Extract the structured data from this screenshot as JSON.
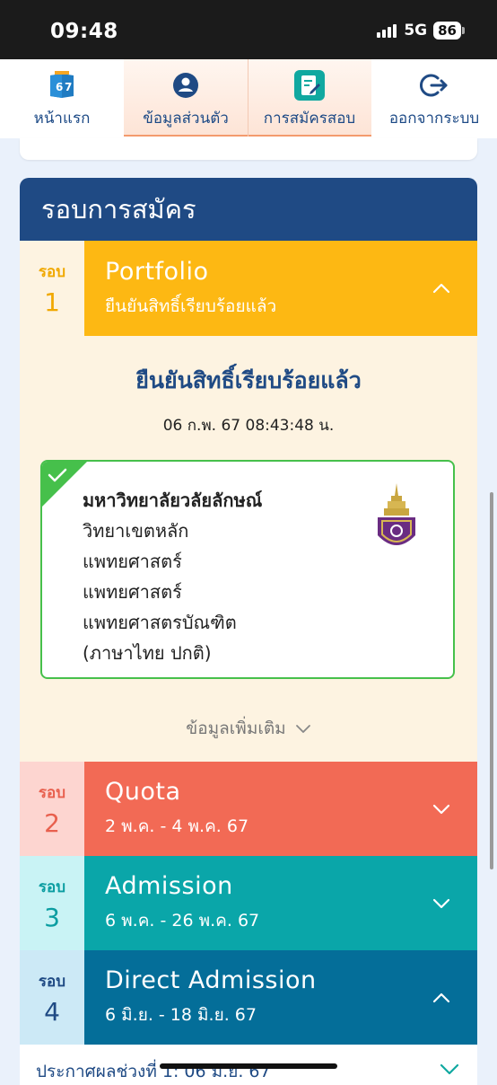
{
  "status_bar": {
    "time": "09:48",
    "network": "5G",
    "battery": "86"
  },
  "nav": {
    "items": [
      {
        "label": "หน้าแรก",
        "icon": "home-67-icon",
        "active": false
      },
      {
        "label": "ข้อมูลส่วนตัว",
        "icon": "profile-icon",
        "active": true
      },
      {
        "label": "การสมัครสอบ",
        "icon": "application-form-icon",
        "active": true
      },
      {
        "label": "ออกจากระบบ",
        "icon": "logout-icon",
        "active": false
      }
    ]
  },
  "panel": {
    "title": "รอบการสมัคร"
  },
  "rounds": [
    {
      "round_label": "รอบ",
      "number": "1",
      "name": "Portfolio",
      "subtitle": "ยืนยันสิทธิ์เรียบร้อยแล้ว",
      "expanded": true,
      "left_bg": "#fdf3e1",
      "right_bg": "#fdb813",
      "label_color": "#f0a800"
    },
    {
      "round_label": "รอบ",
      "number": "2",
      "name": "Quota",
      "subtitle": "2 พ.ค. - 4 พ.ค. 67",
      "expanded": false,
      "left_bg": "#fdd5d0",
      "right_bg": "#f26a55",
      "label_color": "#e8604e"
    },
    {
      "round_label": "รอบ",
      "number": "3",
      "name": "Admission",
      "subtitle": "6 พ.ค. - 26 พ.ค. 67",
      "expanded": false,
      "left_bg": "#c9f3f5",
      "right_bg": "#0aa6a9",
      "label_color": "#0a9da1"
    },
    {
      "round_label": "รอบ",
      "number": "4",
      "name": "Direct Admission",
      "subtitle": "6 มิ.ย. - 18 มิ.ย. 67",
      "expanded": true,
      "left_bg": "#cce9f6",
      "right_bg": "#046e99",
      "label_color": "#1f4a84"
    }
  ],
  "confirmation": {
    "title": "ยืนยันสิทธิ์เรียบร้อยแล้ว",
    "timestamp": "06 ก.พ. 67 08:43:48 น.",
    "university": "มหาวิทยาลัยวลัยลักษณ์",
    "campus": "วิทยาเขตหลัก",
    "faculty": "แพทยศาสตร์",
    "department": "แพทยศาสตร์",
    "program": "แพทยศาสตรบัณฑิต",
    "program_type": "(ภาษาไทย ปกติ)",
    "more_label": "ข้อมูลเพิ่มเติม"
  },
  "result_row": {
    "label": "ประกาศผลช่วงที่ 1: 06 มิ.ย. 67"
  }
}
